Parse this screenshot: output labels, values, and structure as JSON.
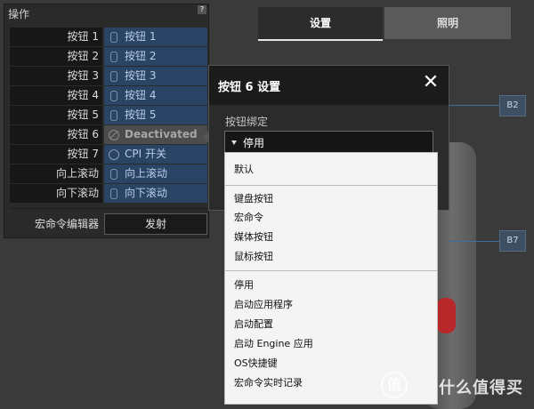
{
  "left_panel": {
    "title": "操作",
    "help": "?",
    "rows": [
      {
        "label": "按钮 1",
        "value": "按钮 1"
      },
      {
        "label": "按钮 2",
        "value": "按钮 2"
      },
      {
        "label": "按钮 3",
        "value": "按钮 3"
      },
      {
        "label": "按钮 4",
        "value": "按钮 4"
      },
      {
        "label": "按钮 5",
        "value": "按钮 5"
      },
      {
        "label": "按钮 6",
        "value": "Deactivated"
      },
      {
        "label": "按钮 7",
        "value": "CPI 开关"
      },
      {
        "label": "向上滚动",
        "value": "向上滚动"
      },
      {
        "label": "向下滚动",
        "value": "向下滚动"
      }
    ],
    "macro_editor_label": "宏命令编辑器",
    "fire_button": "发射"
  },
  "tabs": {
    "settings": "设置",
    "lighting": "照明"
  },
  "dialog": {
    "title": "按钮 6 设置",
    "close": "✕",
    "binding_label": "按钮绑定",
    "binding_value": "停用"
  },
  "dropdown": {
    "groups": [
      [
        "默认"
      ],
      [
        "键盘按钮",
        "宏命令",
        "媒体按钮",
        "鼠标按钮"
      ],
      [
        "停用",
        "启动应用程序",
        "启动配置",
        "启动 Engine 应用",
        "OS快捷键",
        "宏命令实时记录"
      ]
    ]
  },
  "mouse_tags": {
    "b2": "B2",
    "b7": "B7"
  },
  "colors": {
    "assigned_row": "#2a4466",
    "deactivated_row": "#4c4c4c",
    "accent_orange": "#ef5a22",
    "leader_line": "#3c6ea0"
  },
  "watermark": {
    "mark": "值",
    "text": "什么值得买"
  }
}
